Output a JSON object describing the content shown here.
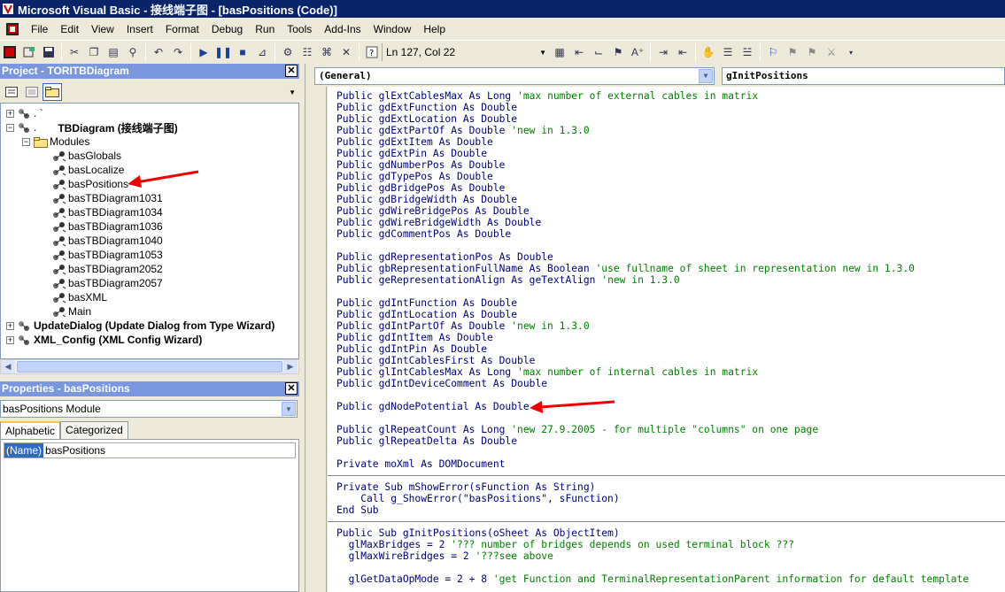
{
  "window": {
    "title": "Microsoft Visual Basic - 接线端子图 - [basPositions (Code)]"
  },
  "menu": [
    "File",
    "Edit",
    "View",
    "Insert",
    "Format",
    "Debug",
    "Run",
    "Tools",
    "Add-Ins",
    "Window",
    "Help"
  ],
  "toolbar": {
    "position": "Ln 127, Col 22"
  },
  "project": {
    "header": "Project - TORITBDiagram",
    "close": "✕",
    "root1": ". `",
    "root2_prefix": ".",
    "root2": "TBDiagram (接线端子图)",
    "modules_folder": "Modules",
    "modules": [
      "basGlobals",
      "basLocalize",
      "basPositions",
      "basTBDiagram1031",
      "basTBDiagram1034",
      "basTBDiagram1036",
      "basTBDiagram1040",
      "basTBDiagram1053",
      "basTBDiagram2052",
      "basTBDiagram2057",
      "basXML",
      "Main"
    ],
    "other1": "UpdateDialog (Update Dialog from Type Wizard)",
    "other2": "XML_Config (XML Config Wizard)"
  },
  "properties": {
    "header": "Properties - basPositions",
    "object_name": "basPositions",
    "object_type": "Module",
    "tabs": [
      "Alphabetic",
      "Categorized"
    ],
    "row_name": "(Name)",
    "row_value": "basPositions"
  },
  "code": {
    "object_combo": "(General)",
    "proc_combo": "gInitPositions",
    "lines": [
      {
        "code": "Public glExtCablesMax As Long",
        "comment": "'max number of external cables in matrix"
      },
      {
        "code": "Public gdExtFunction As Double",
        "comment": ""
      },
      {
        "code": "Public gdExtLocation As Double",
        "comment": ""
      },
      {
        "code": "Public gdExtPartOf As Double",
        "comment": "'new in 1.3.0"
      },
      {
        "code": "Public gdExtItem As Double",
        "comment": ""
      },
      {
        "code": "Public gdExtPin As Double",
        "comment": ""
      },
      {
        "code": "Public gdNumberPos As Double",
        "comment": ""
      },
      {
        "code": "Public gdTypePos As Double",
        "comment": ""
      },
      {
        "code": "Public gdBridgePos As Double",
        "comment": ""
      },
      {
        "code": "Public gdBridgeWidth As Double",
        "comment": ""
      },
      {
        "code": "Public gdWireBridgePos As Double",
        "comment": ""
      },
      {
        "code": "Public gdWireBridgeWidth As Double",
        "comment": ""
      },
      {
        "code": "Public gdCommentPos As Double",
        "comment": ""
      },
      {
        "code": "",
        "comment": ""
      },
      {
        "code": "Public gdRepresentationPos As Double",
        "comment": ""
      },
      {
        "code": "Public gbRepresentationFullName As Boolean",
        "comment": "'use fullname of sheet in representation new in 1.3.0"
      },
      {
        "code": "Public geRepresentationAlign As geTextAlign",
        "comment": "'new in 1.3.0"
      },
      {
        "code": "",
        "comment": ""
      },
      {
        "code": "Public gdIntFunction As Double",
        "comment": ""
      },
      {
        "code": "Public gdIntLocation As Double",
        "comment": ""
      },
      {
        "code": "Public gdIntPartOf As Double",
        "comment": "'new in 1.3.0"
      },
      {
        "code": "Public gdIntItem As Double",
        "comment": ""
      },
      {
        "code": "Public gdIntPin As Double",
        "comment": ""
      },
      {
        "code": "Public gdIntCablesFirst As Double",
        "comment": ""
      },
      {
        "code": "Public glIntCablesMax As Long",
        "comment": "'max number of internal cables in matrix"
      },
      {
        "code": "Public gdIntDeviceComment As Double",
        "comment": ""
      },
      {
        "code": "",
        "comment": ""
      },
      {
        "code": "Public gdNodePotential As Double",
        "comment": ""
      },
      {
        "code": "",
        "comment": ""
      },
      {
        "code": "Public glRepeatCount As Long",
        "comment": "'new 27.9.2005 - for multiple \"columns\" on one page"
      },
      {
        "code": "Public glRepeatDelta As Double",
        "comment": ""
      },
      {
        "code": "",
        "comment": ""
      },
      {
        "code": "Private moXml As DOMDocument",
        "comment": ""
      },
      {
        "code": "",
        "comment": ""
      },
      {
        "code": "Private Sub mShowError(sFunction As String)",
        "comment": ""
      },
      {
        "code": "    Call g_ShowError(\"basPositions\", sFunction)",
        "comment": ""
      },
      {
        "code": "End Sub",
        "comment": ""
      },
      {
        "code": "",
        "comment": ""
      },
      {
        "code": "Public Sub gInitPositions(oSheet As ObjectItem)",
        "comment": ""
      },
      {
        "code": "  glMaxBridges = 2",
        "comment": "'??? number of bridges depends on used terminal block ???"
      },
      {
        "code": "  glMaxWireBridges = 2",
        "comment": "'???see above"
      },
      {
        "code": "",
        "comment": ""
      },
      {
        "code": "  glGetDataOpMode = 2 + 8",
        "comment": "'get Function and TerminalRepresentationParent information for default template"
      }
    ]
  }
}
